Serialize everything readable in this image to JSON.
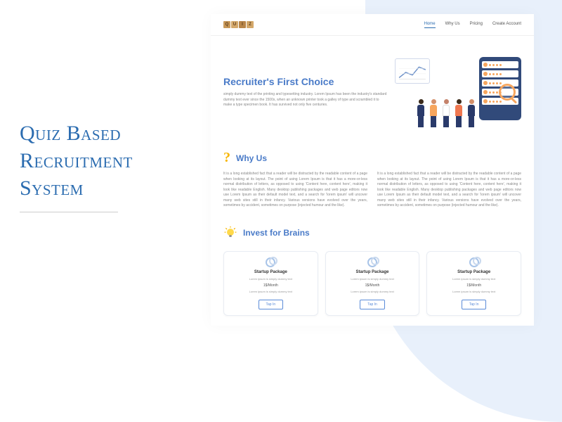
{
  "left": {
    "title": "Quiz Based Recruitment System"
  },
  "logo": [
    "Q",
    "U",
    "I",
    "Z"
  ],
  "nav": {
    "home": "Home",
    "why": "Why Us",
    "pricing": "Pricing",
    "create": "Create Account"
  },
  "hero": {
    "title": "Recruiter's First Choice",
    "body": "simply dummy text of the printing and typesetting industry. Lorem Ipsum has been the industry's standard dummy text ever since the 1500s, when an unknown printer took a galley of type and scrambled it to make a type specimen book. It has survived not only five centuries."
  },
  "why": {
    "title": "Why Us",
    "col1": "It is a long established fact that a reader will be distracted by the readable content of a page when looking at its layout. The point of using Lorem Ipsum is that it has a more-or-less normal distribution of letters, as opposed to using 'Content here, content here', making it look like readable English. Many desktop publishing packages and web page editors now use Lorem Ipsum as their default model text, and a search for 'lorem ipsum' will uncover many web sites still in their infancy. Various versions have evolved over the years, sometimes by accident, sometimes on purpose (injected humour and the like).",
    "col2": "It is a long established fact that a reader will be distracted by the readable content of a page when looking at its layout. The point of using Lorem Ipsum is that it has a more-or-less normal distribution of letters, as opposed to using 'Content here, content here', making it look like readable English. Many desktop publishing packages and web page editors now use Lorem Ipsum as their default model text, and a search for 'lorem ipsum' will uncover many web sites still in their infancy. Various versions have evolved over the years, sometimes by accident, sometimes on purpose (injected humour and the like)."
  },
  "invest": {
    "title": "Invest for Brains"
  },
  "cards": [
    {
      "title": "Startup Package",
      "text1": "Lorem ipsum is simply dummy text",
      "price": "1$/Month",
      "text2": "Lorem ipsum is simply dummy text",
      "btn": "Tap In"
    },
    {
      "title": "Startup Package",
      "text1": "Lorem ipsum is simply dummy text",
      "price": "1$/Month",
      "text2": "Lorem ipsum is simply dummy text",
      "btn": "Tap In"
    },
    {
      "title": "Startup Package",
      "text1": "Lorem ipsum is simply dummy text",
      "price": "1$/Month",
      "text2": "Lorem ipsum is simply dummy text",
      "btn": "Tap In"
    }
  ]
}
